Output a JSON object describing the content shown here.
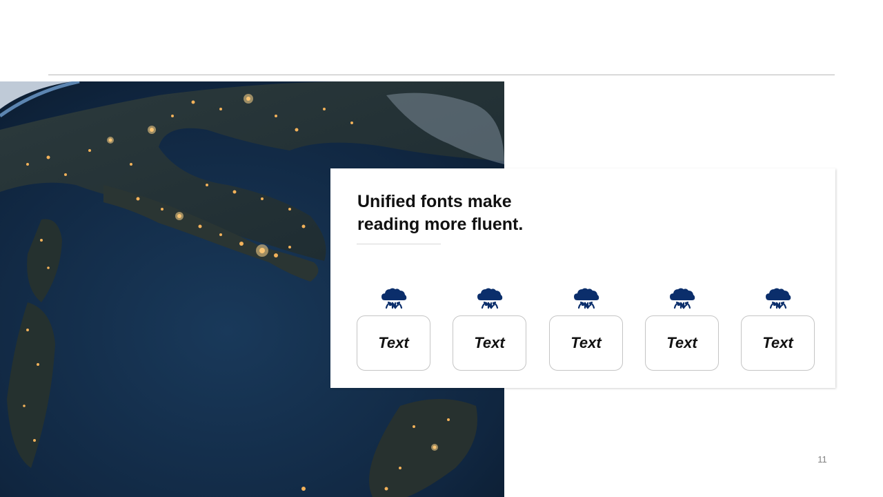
{
  "slide": {
    "title_lines": [
      "Unified fonts make",
      "reading more fluent."
    ],
    "page_number": "11"
  },
  "features": [
    {
      "icon": "cloud-transfer-icon",
      "label": "Text"
    },
    {
      "icon": "cloud-transfer-icon",
      "label": "Text"
    },
    {
      "icon": "cloud-transfer-icon",
      "label": "Text"
    },
    {
      "icon": "cloud-transfer-icon",
      "label": "Text"
    },
    {
      "icon": "cloud-transfer-icon",
      "label": "Text"
    }
  ],
  "colors": {
    "icon": "#0b2e6b",
    "ocean": "#12304d",
    "city_lights": "#f3b25a",
    "rule": "#b8b8b8"
  }
}
